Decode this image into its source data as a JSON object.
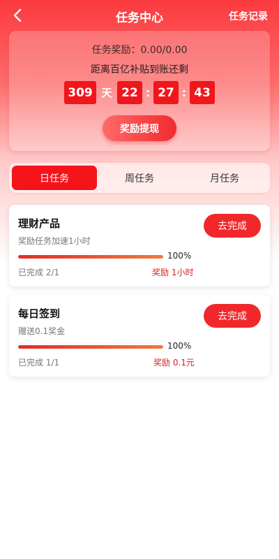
{
  "header": {
    "title": "任务中心",
    "records_label": "任务记录"
  },
  "reward": {
    "line": "任务奖励：0.00/0.00",
    "countdown_label": "距离百亿补贴到账还剩",
    "days": "309",
    "day_unit": "天",
    "hours": "22",
    "minutes": "27",
    "seconds": "43",
    "separator": ":",
    "withdraw_label": "奖励提现"
  },
  "tabs": [
    {
      "label": "日任务",
      "active": true
    },
    {
      "label": "周任务",
      "active": false
    },
    {
      "label": "月任务",
      "active": false
    }
  ],
  "tasks": [
    {
      "name": "理财产品",
      "desc": "奖励任务加速1小时",
      "button": "去完成",
      "progress": 1.0,
      "progress_text": "100%",
      "done_text": "已完成 2/1",
      "reward_text": "奖励 1小时"
    },
    {
      "name": "每日签到",
      "desc": "赠送0.1奖金",
      "button": "去完成",
      "progress": 1.0,
      "progress_text": "100%",
      "done_text": "已完成 1/1",
      "reward_text": "奖励 0.1元"
    }
  ],
  "colors": {
    "primary_red": "#f0282c",
    "reward_red": "#d81e1e"
  },
  "icons": {
    "back": "chevron-left-icon"
  }
}
